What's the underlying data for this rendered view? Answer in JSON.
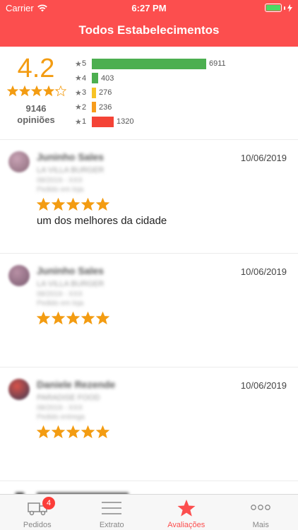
{
  "status": {
    "carrier": "Carrier",
    "time": "6:27 PM"
  },
  "header": {
    "title": "Todos Estabelecimentos"
  },
  "summary": {
    "average": "4.2",
    "rating_value": 4.2,
    "total_count": "9146",
    "total_label": "opiniões",
    "distribution": [
      {
        "star": "5",
        "count": "6911",
        "value": 6911,
        "color": "#4caf50"
      },
      {
        "star": "4",
        "count": "403",
        "value": 403,
        "color": "#4caf50"
      },
      {
        "star": "3",
        "count": "276",
        "value": 276,
        "color": "#f7c325"
      },
      {
        "star": "2",
        "count": "236",
        "value": 236,
        "color": "#f79c1b"
      },
      {
        "star": "1",
        "count": "1320",
        "value": 1320,
        "color": "#f44336"
      }
    ]
  },
  "reviews": [
    {
      "name": "Juninho Sales",
      "store": "LA VILLA BURGER",
      "line3": "08/2019 - XXX",
      "line4": "Pedido em loja",
      "date": "10/06/2019",
      "stars": 5,
      "comment": "um dos melhores da cidade"
    },
    {
      "name": "Juninho Sales",
      "store": "LA VILLA BURGER",
      "line3": "08/2019 - XXX",
      "line4": "Pedido em loja",
      "date": "10/06/2019",
      "stars": 5,
      "comment": ""
    },
    {
      "name": "Daniele Rezende",
      "store": "PARADISE FOOD",
      "line3": "08/2019 - XXX",
      "line4": "Pedido entrega",
      "date": "10/06/2019",
      "stars": 5,
      "comment": ""
    }
  ],
  "tabbar": {
    "tabs": [
      {
        "label": "Pedidos",
        "icon": "truck-icon",
        "badge": "4"
      },
      {
        "label": "Extrato",
        "icon": "list-icon"
      },
      {
        "label": "Avaliações",
        "icon": "star-icon",
        "active": true
      },
      {
        "label": "Mais",
        "icon": "more-icon"
      }
    ]
  },
  "colors": {
    "brand": "#fc4e4e",
    "star": "#f39c12",
    "average": "#f39c12"
  }
}
